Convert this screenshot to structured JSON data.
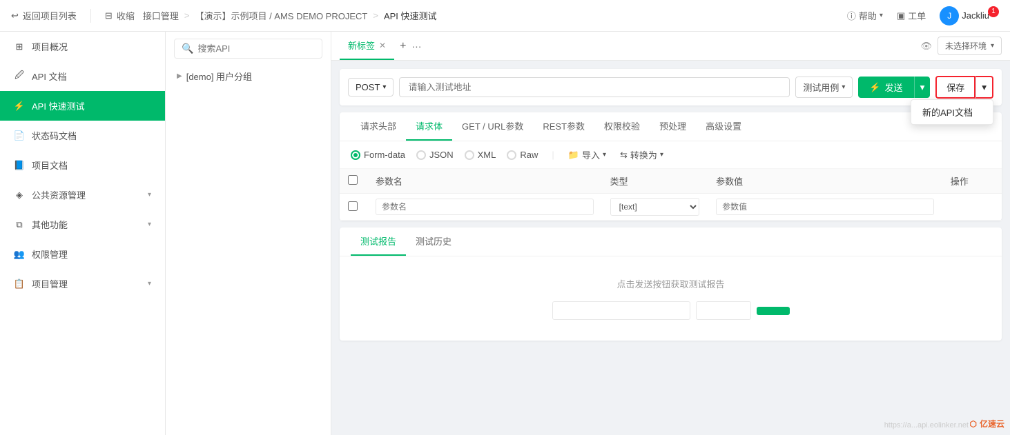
{
  "header": {
    "back_label": "返回项目列表",
    "collapse_label": "收缩",
    "nav": {
      "part1": "接口管理",
      "sep1": ">",
      "part2": "【演示】示例项目 / AMS DEMO PROJECT",
      "sep2": ">",
      "part3": "API 快速测试"
    },
    "help_label": "帮助",
    "workorder_label": "工单",
    "user_name": "Jackliu",
    "badge": "1"
  },
  "sidebar": {
    "items": [
      {
        "id": "project-overview",
        "icon": "grid",
        "label": "项目概况",
        "has_arrow": false
      },
      {
        "id": "api-docs",
        "icon": "file-text",
        "label": "API 文档",
        "has_arrow": false
      },
      {
        "id": "api-test",
        "icon": "zap",
        "label": "API 快速测试",
        "has_arrow": false,
        "active": true
      },
      {
        "id": "status-code",
        "icon": "file",
        "label": "状态码文档",
        "has_arrow": false
      },
      {
        "id": "project-docs",
        "icon": "book",
        "label": "项目文档",
        "has_arrow": false
      },
      {
        "id": "public-resources",
        "icon": "box",
        "label": "公共资源管理",
        "has_arrow": true
      },
      {
        "id": "other-functions",
        "icon": "layers",
        "label": "其他功能",
        "has_arrow": true
      },
      {
        "id": "permission-mgmt",
        "icon": "users",
        "label": "权限管理",
        "has_arrow": false
      },
      {
        "id": "project-mgmt",
        "icon": "settings",
        "label": "项目管理",
        "has_arrow": true
      }
    ]
  },
  "left_panel": {
    "search_placeholder": "搜索API",
    "tree_items": [
      {
        "label": "[demo] 用户分组",
        "has_arrow": true
      }
    ]
  },
  "tabs": {
    "items": [
      {
        "label": "新标签",
        "active": true,
        "closable": true
      }
    ],
    "add_btn": "+",
    "more_btn": "···",
    "env_label": "未选择环境"
  },
  "url_bar": {
    "method": "POST",
    "placeholder": "请输入测试地址",
    "test_case_label": "测试用例",
    "send_label": "发送",
    "save_label": "保存"
  },
  "params_tabs": {
    "items": [
      {
        "label": "请求头部",
        "active": false
      },
      {
        "label": "请求体",
        "active": true
      },
      {
        "label": "GET / URL参数",
        "active": false
      },
      {
        "label": "REST参数",
        "active": false
      },
      {
        "label": "权限校验",
        "active": false
      },
      {
        "label": "预处理",
        "active": false
      },
      {
        "label": "高级设置",
        "active": false
      }
    ]
  },
  "body_types": {
    "options": [
      {
        "label": "Form-data",
        "selected": true
      },
      {
        "label": "JSON",
        "selected": false
      },
      {
        "label": "XML",
        "selected": false
      },
      {
        "label": "Raw",
        "selected": false
      }
    ],
    "import_label": "导入",
    "convert_label": "转换为"
  },
  "table": {
    "columns": [
      "参数名",
      "类型",
      "参数值",
      "操作"
    ],
    "rows": [
      {
        "param_name_placeholder": "参数名",
        "type_value": "[text]",
        "param_value_placeholder": "参数值"
      }
    ]
  },
  "report": {
    "tabs": [
      {
        "label": "测试报告",
        "active": true
      },
      {
        "label": "测试历史",
        "active": false
      }
    ],
    "hint": "点击发送按钮获取测试报告"
  },
  "dropdown": {
    "save_menu": [
      {
        "label": "新的API文档"
      }
    ]
  },
  "watermark": "https://a...api.eolinker.net",
  "logo": "亿速云"
}
